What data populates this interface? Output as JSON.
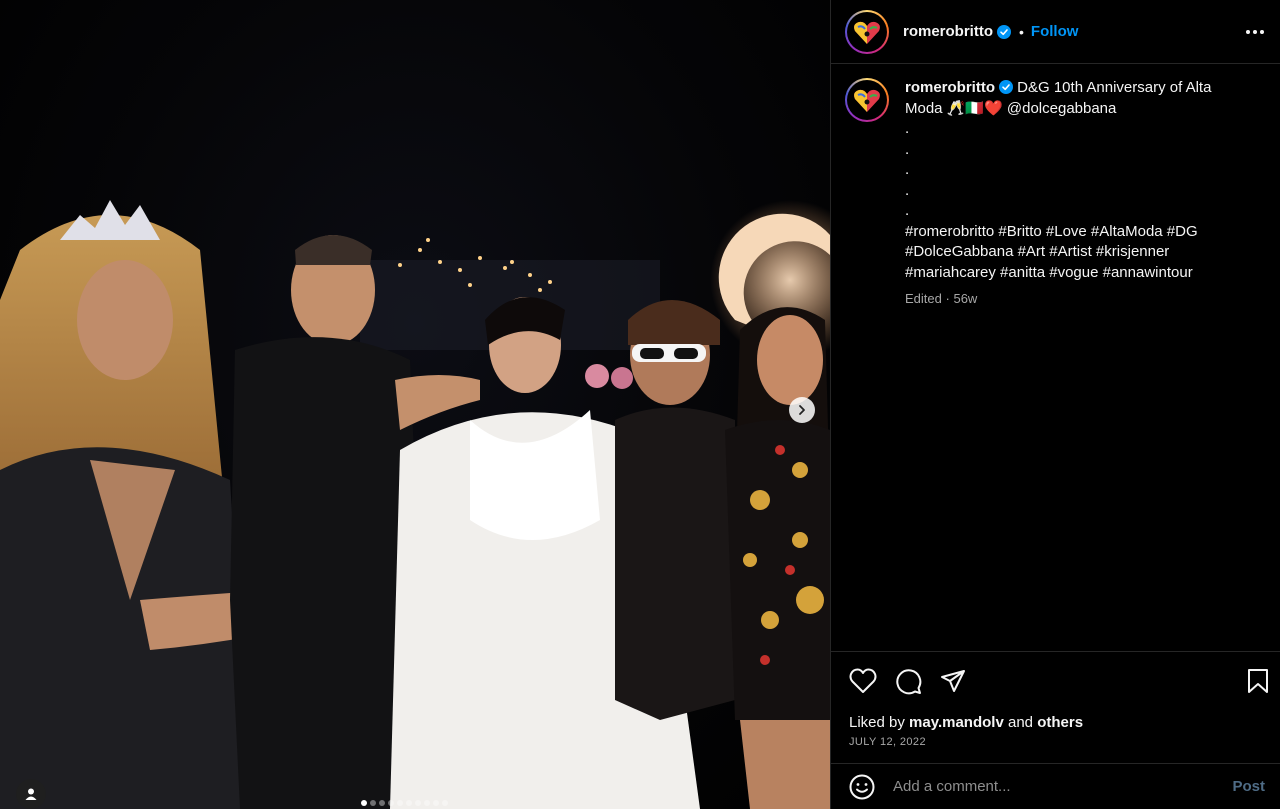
{
  "post": {
    "image_alt": "Group photo at D&G Alta Moda anniversary party at night",
    "carousel_count": 10,
    "carousel_active": 0
  },
  "header": {
    "username": "romerobritto",
    "separator": "•",
    "follow_label": "Follow"
  },
  "caption": {
    "username": "romerobritto",
    "text_line1": "D&G 10th Anniversary of Alta Moda 🥂🇮🇹❤️ @dolcegabbana",
    "dots": [
      ".",
      ".",
      ".",
      ".",
      "."
    ],
    "hashtags": "#romerobritto #Britto #Love #AltaModa #DG #DolceGabbana #Art #Artist #krisjenner #mariahcarey #anitta #vogue #annawintour",
    "edited": "Edited",
    "age_separator": "·",
    "age": "56w"
  },
  "likes": {
    "prefix": "Liked by",
    "user": "may.mandolv",
    "and": "and",
    "others": "others"
  },
  "date": "JULY 12, 2022",
  "comment": {
    "placeholder": "Add a comment...",
    "post_label": "Post"
  },
  "icons": {
    "verified": "verified-badge-icon",
    "more": "more-options-icon",
    "like": "heart-icon",
    "comment": "comment-icon",
    "share": "share-icon",
    "save": "bookmark-icon",
    "emoji": "emoji-icon",
    "next": "chevron-right-icon",
    "tag": "user-tag-icon"
  },
  "colors": {
    "accent": "#0095f6",
    "background": "#000000",
    "muted": "#a8a8a8",
    "divider": "#262626"
  }
}
